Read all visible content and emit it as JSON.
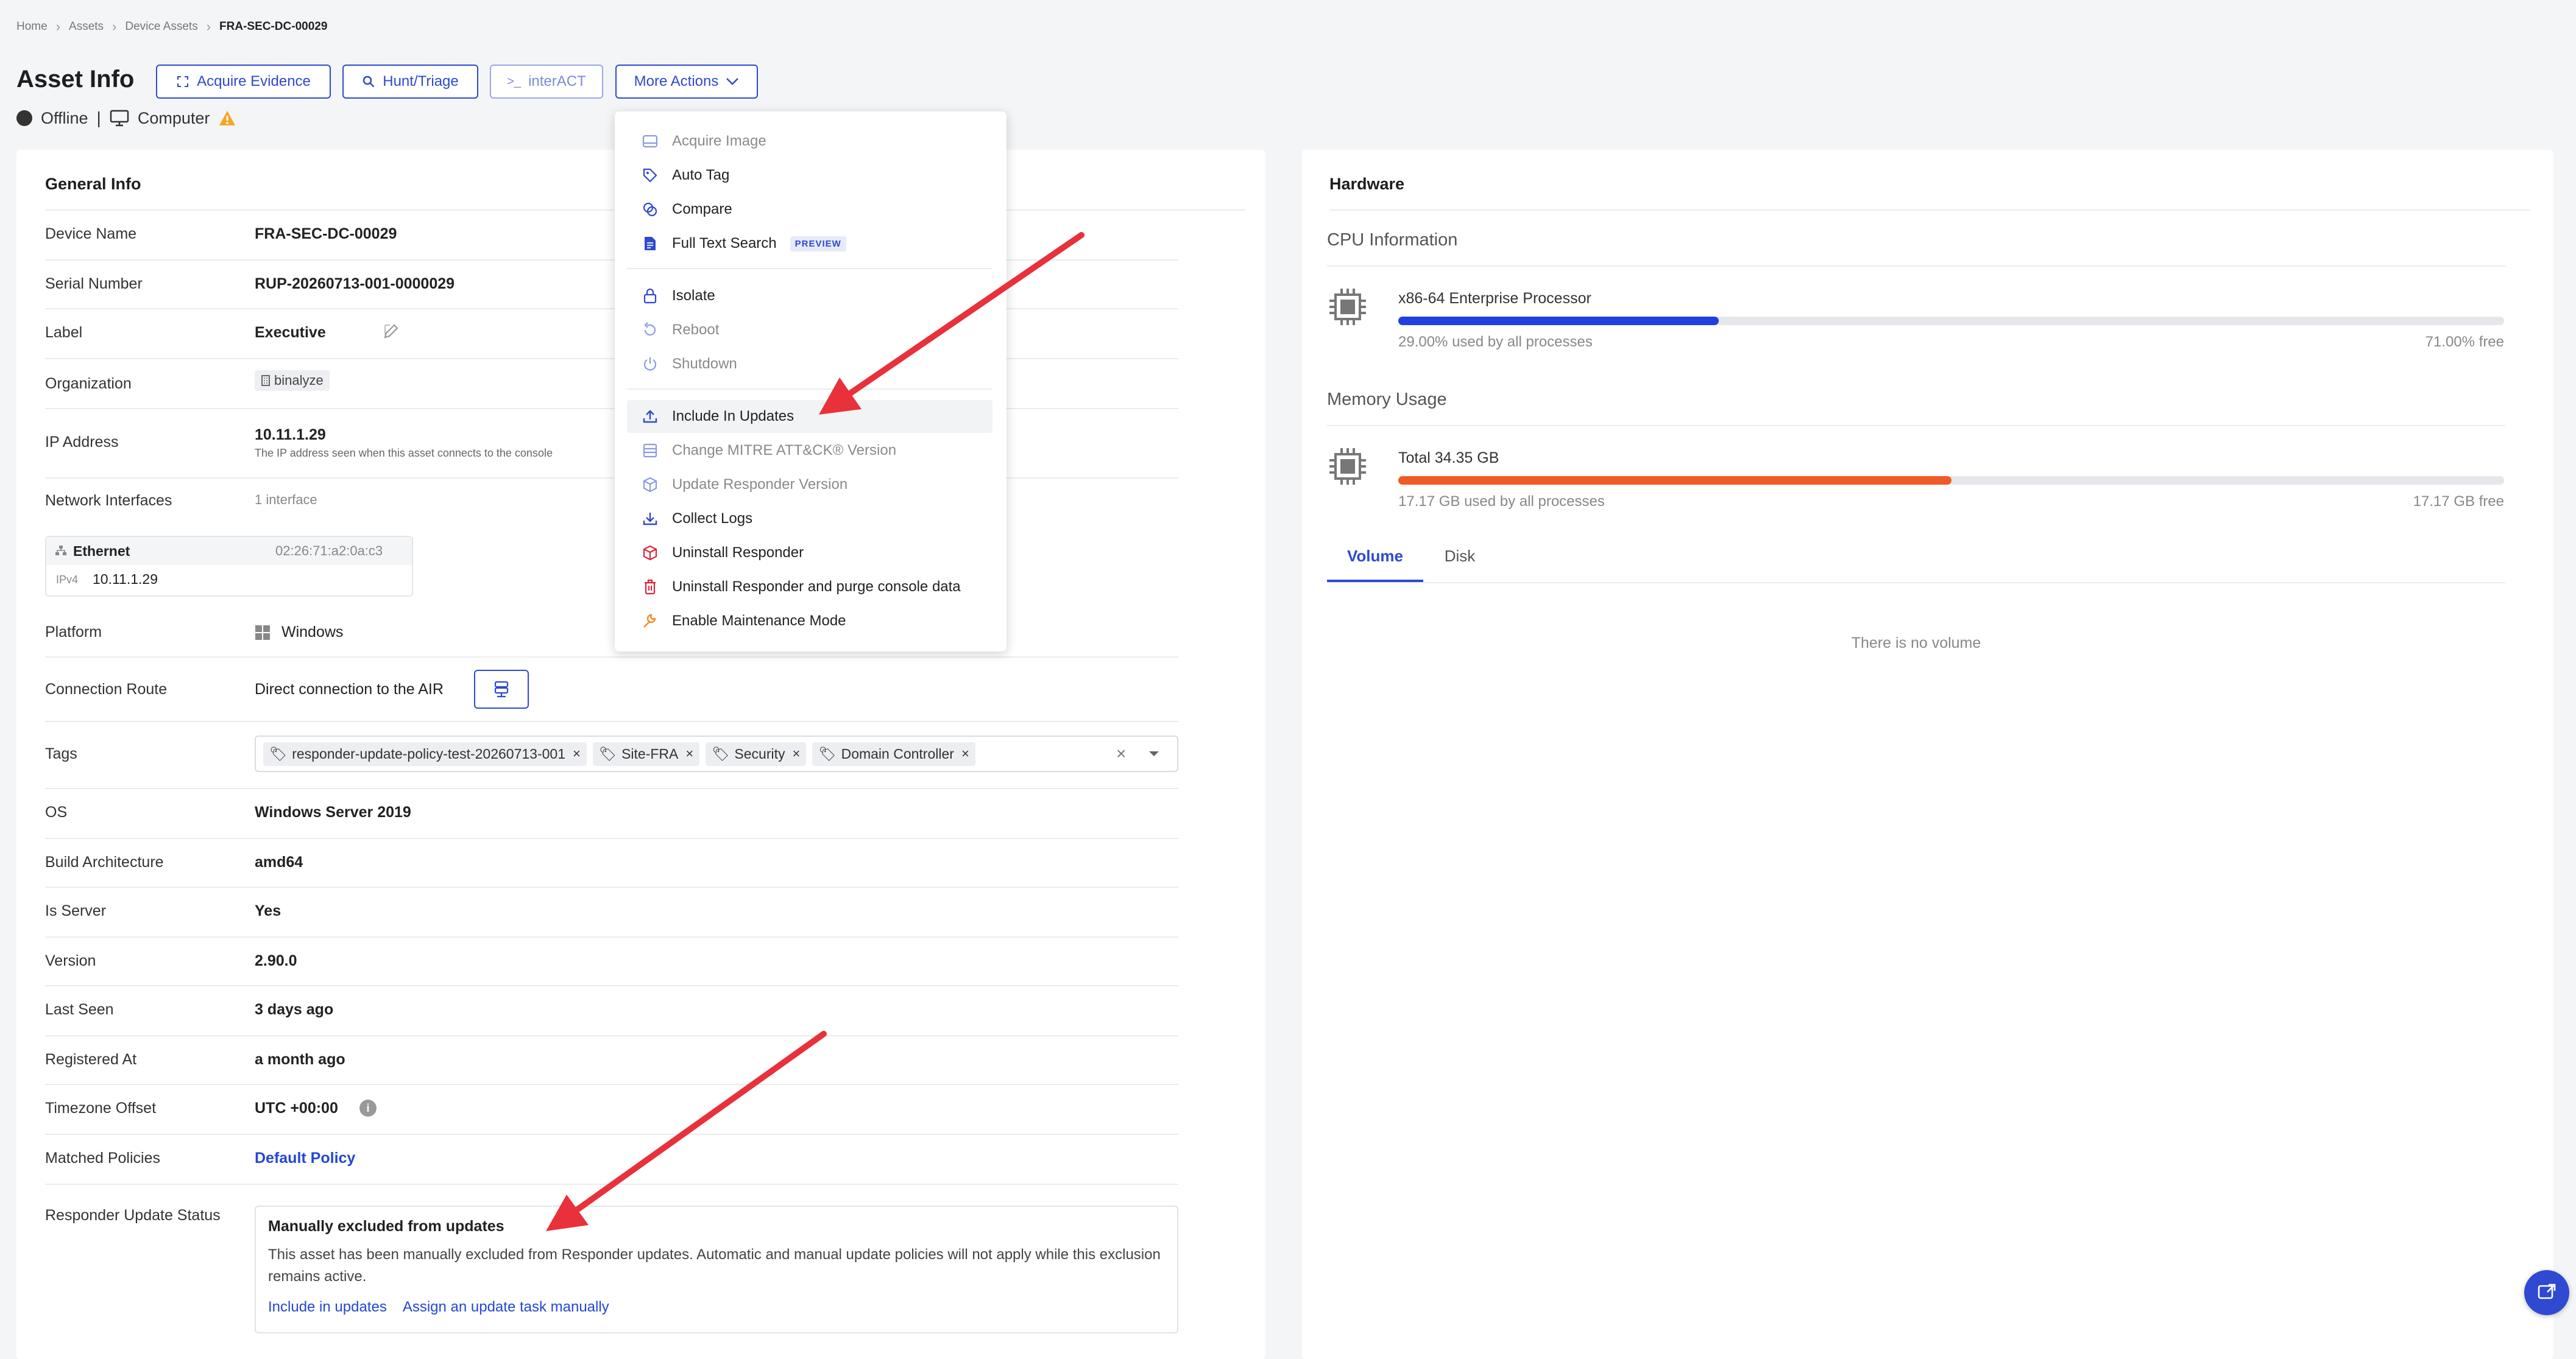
{
  "breadcrumb": [
    "Home",
    "Assets",
    "Device Assets",
    "FRA-SEC-DC-00029"
  ],
  "header": {
    "title": "Asset Info",
    "buttons": {
      "acquire": "Acquire Evidence",
      "hunt": "Hunt/Triage",
      "interact": "interACT",
      "more": "More Actions"
    },
    "status": "Offline",
    "type": "Computer"
  },
  "general": {
    "title": "General Info",
    "device_name": {
      "label": "Device Name",
      "value": "FRA-SEC-DC-00029"
    },
    "serial": {
      "label": "Serial Number",
      "value": "RUP-20260713-001-0000029"
    },
    "label": {
      "label": "Label",
      "value": "Executive"
    },
    "organization": {
      "label": "Organization",
      "value": "binalyze"
    },
    "ip": {
      "label": "IP Address",
      "value": "10.11.1.29",
      "hint": "The IP address seen when this asset connects to the console"
    },
    "network": {
      "label": "Network Interfaces",
      "value": "1 interface",
      "iface_name": "Ethernet",
      "mac": "02:26:71:a2:0a:c3",
      "ip_label": "IPv4",
      "ip_value": "10.11.1.29"
    },
    "platform": {
      "label": "Platform",
      "value": "Windows"
    },
    "connection": {
      "label": "Connection Route",
      "value": "Direct connection to the AIR"
    },
    "tags": {
      "label": "Tags",
      "items": [
        "responder-update-policy-test-20260713-001",
        "Site-FRA",
        "Security",
        "Domain Controller"
      ]
    },
    "os": {
      "label": "OS",
      "value": "Windows Server 2019"
    },
    "arch": {
      "label": "Build Architecture",
      "value": "amd64"
    },
    "is_server": {
      "label": "Is Server",
      "value": "Yes"
    },
    "version": {
      "label": "Version",
      "value": "2.90.0"
    },
    "last_seen": {
      "label": "Last Seen",
      "value": "3 days ago"
    },
    "registered": {
      "label": "Registered At",
      "value": "a month ago"
    },
    "timezone": {
      "label": "Timezone Offset",
      "value": "UTC +00:00"
    },
    "policies": {
      "label": "Matched Policies",
      "value": "Default Policy"
    },
    "update_status": {
      "label": "Responder Update Status",
      "title": "Manually excluded from updates",
      "desc": "This asset has been manually excluded from Responder updates. Automatic and manual update policies will not apply while this exclusion remains active.",
      "link1": "Include in updates",
      "link2": "Assign an update task manually"
    }
  },
  "menu": {
    "g1": [
      "Acquire Image",
      "Auto Tag",
      "Compare",
      "Full Text Search"
    ],
    "preview": "PREVIEW",
    "g2": [
      "Isolate",
      "Reboot",
      "Shutdown"
    ],
    "g3": [
      "Include In Updates",
      "Change MITRE ATT&CK® Version",
      "Update Responder Version",
      "Collect Logs",
      "Uninstall Responder",
      "Uninstall Responder and purge console data",
      "Enable Maintenance Mode"
    ]
  },
  "hardware": {
    "title": "Hardware",
    "cpu_title": "CPU Information",
    "cpu_name": "x86-64 Enterprise Processor",
    "cpu_used_pct": 29,
    "cpu_used": "29.00% used by all processes",
    "cpu_free": "71.00% free",
    "mem_title": "Memory Usage",
    "mem_total": "Total 34.35 GB",
    "mem_used_pct": 50,
    "mem_used": "17.17 GB used by all processes",
    "mem_free": "17.17 GB free",
    "tabs": [
      "Volume",
      "Disk"
    ],
    "empty": "There is no volume"
  },
  "colors": {
    "accent": "#2f49d1",
    "cpu_bar": "#1f3fe0",
    "mem_bar": "#f15a24",
    "annotation": "#e8313a"
  }
}
